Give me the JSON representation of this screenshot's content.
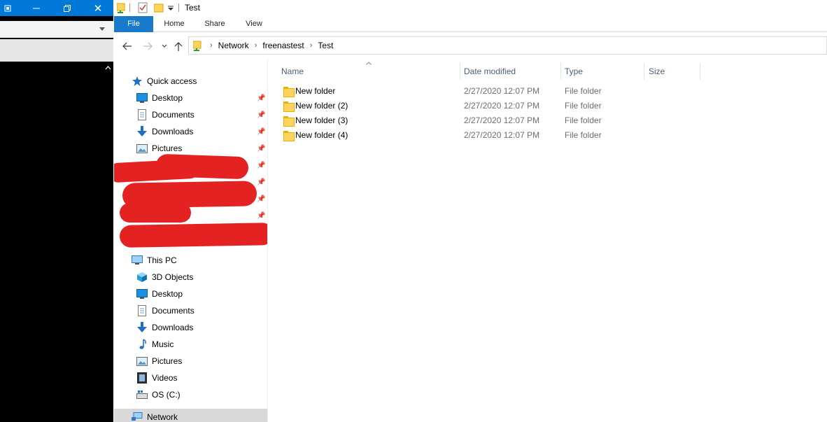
{
  "background_window": {
    "minimize_icon": "minimize-icon",
    "maximize_icon": "restore-icon",
    "close_icon": "close-icon",
    "close_glyph": "✕"
  },
  "explorer": {
    "title": "Test",
    "ribbon_tabs": [
      "File",
      "Home",
      "Share",
      "View"
    ],
    "breadcrumb": [
      "Network",
      "freenastest",
      "Test"
    ],
    "nav": {
      "quick_access": "Quick access",
      "quick_items": [
        {
          "label": "Desktop",
          "icon": "desktop-icon"
        },
        {
          "label": "Documents",
          "icon": "documents-icon"
        },
        {
          "label": "Downloads",
          "icon": "downloads-icon"
        },
        {
          "label": "Pictures",
          "icon": "pictures-icon"
        }
      ],
      "this_pc": "This PC",
      "pc_items": [
        {
          "label": "3D Objects",
          "icon": "3d-objects-icon"
        },
        {
          "label": "Desktop",
          "icon": "desktop-icon"
        },
        {
          "label": "Documents",
          "icon": "documents-icon"
        },
        {
          "label": "Downloads",
          "icon": "downloads-icon"
        },
        {
          "label": "Music",
          "icon": "music-icon"
        },
        {
          "label": "Pictures",
          "icon": "pictures-icon"
        },
        {
          "label": "Videos",
          "icon": "videos-icon"
        },
        {
          "label": "OS (C:)",
          "icon": "drive-icon"
        }
      ],
      "network": "Network"
    },
    "columns": [
      "Name",
      "Date modified",
      "Type",
      "Size"
    ],
    "files": [
      {
        "name": "New folder",
        "date": "2/27/2020 12:07 PM",
        "type": "File folder",
        "size": ""
      },
      {
        "name": "New folder (2)",
        "date": "2/27/2020 12:07 PM",
        "type": "File folder",
        "size": ""
      },
      {
        "name": "New folder (3)",
        "date": "2/27/2020 12:07 PM",
        "type": "File folder",
        "size": ""
      },
      {
        "name": "New folder (4)",
        "date": "2/27/2020 12:07 PM",
        "type": "File folder",
        "size": ""
      }
    ],
    "colors": {
      "accent": "#0078d7",
      "file_tab": "#1979ca",
      "redaction": "#e52222"
    }
  }
}
